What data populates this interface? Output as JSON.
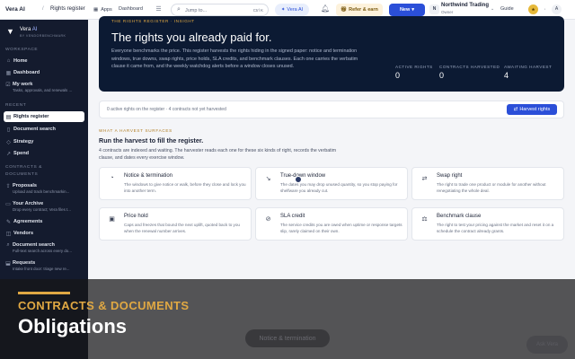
{
  "topbar": {
    "app_name": "Vera AI",
    "separator": "/",
    "breadcrumb": "Rights register",
    "apps_label": "Apps",
    "dashboard_label": "Dashboard",
    "search_placeholder": "Jump to...",
    "search_shortcut": "Ctrl K",
    "vera_ai_label": "Vera AI",
    "refer_label": "Refer & earn",
    "new_label": "New",
    "org_initial": "N",
    "org_name": "Northwind Trading",
    "org_role": "Owner",
    "guide_label": "Guide",
    "user_initial": "A"
  },
  "sidebar": {
    "brand": "Vera",
    "brand_suffix": "AI",
    "byline": "BY VENDORBENCHMARK",
    "sections": {
      "workspace": "WORKSPACE",
      "recent": "RECENT",
      "contracts": "CONTRACTS &",
      "contracts2": "DOCUMENTS"
    },
    "items": [
      {
        "label": "Home"
      },
      {
        "label": "Dashboard"
      },
      {
        "label": "My work",
        "sub": "Tasks, approvals, and renewals ..."
      },
      {
        "label": "Rights register"
      },
      {
        "label": "Document search"
      },
      {
        "label": "Strategy"
      },
      {
        "label": "Spend"
      },
      {
        "label": "Proposals",
        "sub": "Upload and track benchmarkin..."
      },
      {
        "label": "Your Archive",
        "sub": "Drop every contract; Vera files t..."
      },
      {
        "label": "Agreements"
      },
      {
        "label": "Vendors"
      },
      {
        "label": "Document search",
        "sub": "Full-text search across every do..."
      },
      {
        "label": "Requests",
        "sub": "Intake front door: triage new re..."
      }
    ]
  },
  "hero": {
    "tag": "THE RIGHTS REGISTER · INSIGHT",
    "title": "The rights you already paid for.",
    "body": "Everyone benchmarks the price. This register harvests the rights hiding in the signed paper: notice and termination windows, true downs, swap rights, price holds, SLA credits, and benchmark clauses. Each one carries the verbatim clause it came from, and the weekly watchdog alerts before a window closes unused.",
    "stats": [
      {
        "label": "ACTIVE RIGHTS",
        "value": "0"
      },
      {
        "label": "CONTRACTS HARVESTED",
        "value": "0"
      },
      {
        "label": "AWAITING HARVEST",
        "value": "4"
      }
    ]
  },
  "infobar": {
    "text": "0 active rights on the register · 4 contracts not yet harvested",
    "button": "Harvest rights"
  },
  "surfaces": {
    "tag": "WHAT A HARVEST SURFACES",
    "title": "Run the harvest to fill the register.",
    "body": "4 contracts are indexed and waiting. The harvester reads each one for these six kinds of right, records the verbatim clause, and dates every exercise window.",
    "cards": [
      {
        "icon": "bell-icon",
        "title": "Notice & termination",
        "desc": "The windows to give notice or walk, before they close and lock you into another term."
      },
      {
        "icon": "trend-down-icon",
        "title": "True-down window",
        "desc": "The dates you may drop unused quantity, so you stop paying for shelfware you already cut."
      },
      {
        "icon": "swap-icon",
        "title": "Swap right",
        "desc": "The right to trade one product or module for another without renegotiating the whole deal."
      },
      {
        "icon": "lock-icon",
        "title": "Price hold",
        "desc": "Caps and freezes that bound the next uplift, quoted back to you when the renewal number arrives."
      },
      {
        "icon": "sla-icon",
        "title": "SLA credit",
        "desc": "The service credits you are owed when uptime or response targets slip, rarely claimed on their own."
      },
      {
        "icon": "scale-icon",
        "title": "Benchmark clause",
        "desc": "The right to test your pricing against the market and reset it on a schedule the contract already grants."
      }
    ]
  },
  "overlay": {
    "kicker": "CONTRACTS & DOCUMENTS",
    "title": "Obligations",
    "ghost_button": "Notice & termination",
    "ask_button": "Ask Vera"
  },
  "colors": {
    "accent": "#2b4fd8",
    "gold": "#e0a843",
    "sidebar_bg": "#141b2e",
    "hero_bg": "#0c1a33"
  }
}
